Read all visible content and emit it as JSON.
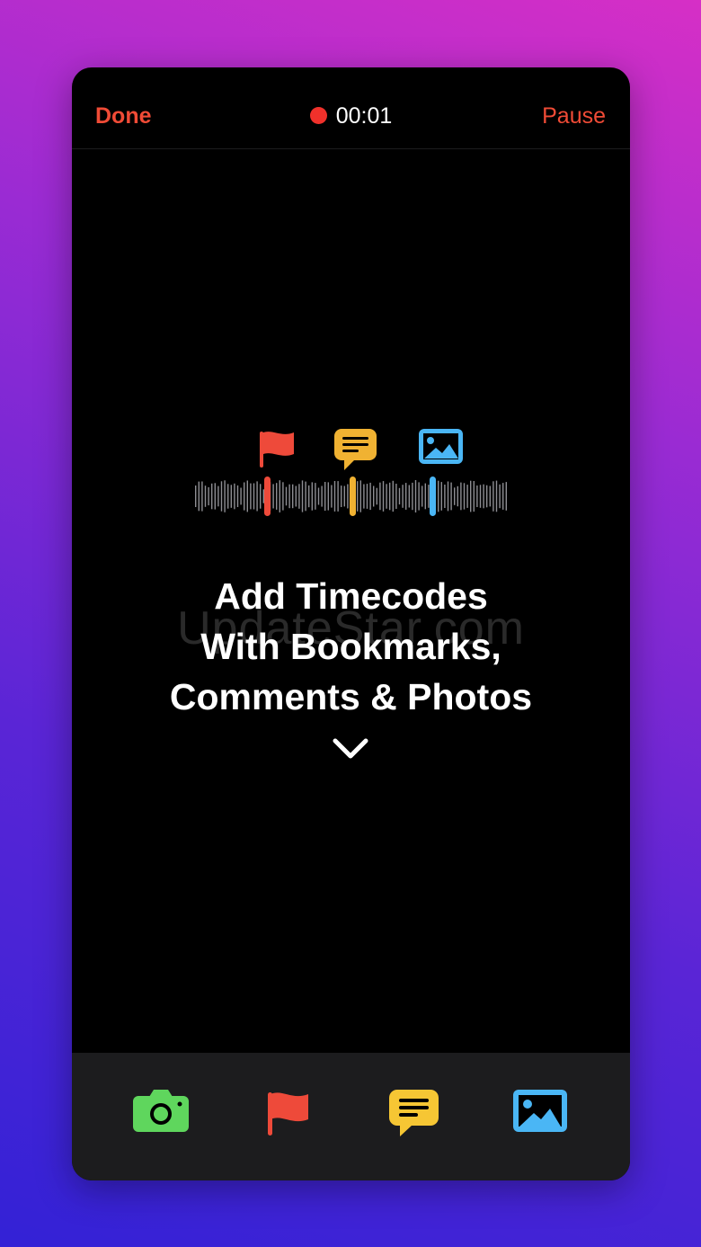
{
  "header": {
    "done_label": "Done",
    "timer": "00:01",
    "pause_label": "Pause"
  },
  "onboarding": {
    "lines": [
      "Add Timecodes",
      "With Bookmarks,",
      "Comments & Photos"
    ]
  },
  "watermark": "UpdateStar.com",
  "toolbar": {
    "items": [
      {
        "icon": "camera-icon",
        "color": "#5fd65d"
      },
      {
        "icon": "flag-icon",
        "color": "#ee4a3a"
      },
      {
        "icon": "comment-icon",
        "color": "#f6c634"
      },
      {
        "icon": "photo-icon",
        "color": "#4ab6f5"
      }
    ]
  },
  "colors": {
    "accent": "#f04b36",
    "record": "#f0312b",
    "bookmark": "#ee4a3a",
    "comment": "#f0b232",
    "photo": "#4ab6f5"
  }
}
